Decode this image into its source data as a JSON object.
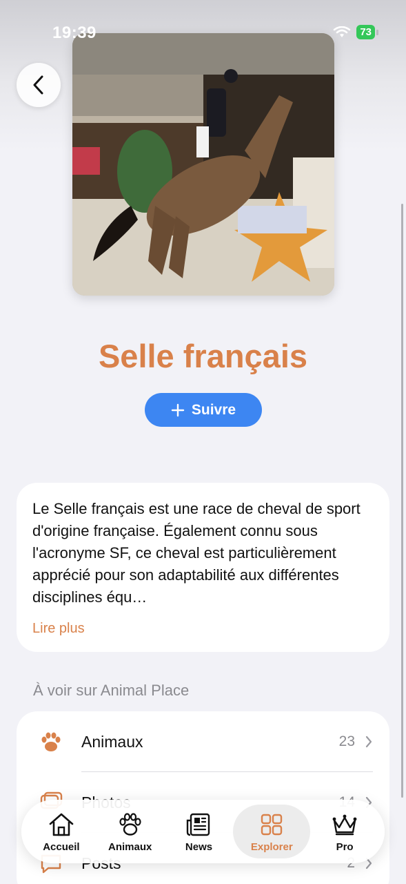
{
  "status": {
    "time": "19:39",
    "battery": "73"
  },
  "breed": {
    "title": "Selle français",
    "follow_label": "Suivre",
    "description": "Le Selle français est une race de cheval de sport d'origine française. Également connu sous l'acronyme SF, ce cheval est particulièrement apprécié pour son adaptabilité aux différentes disciplines équ…",
    "read_more": "Lire plus"
  },
  "section": {
    "title": "À voir sur Animal Place"
  },
  "list": [
    {
      "label": "Animaux",
      "count": "23",
      "icon": "paw-icon"
    },
    {
      "label": "Photos",
      "count": "14",
      "icon": "photos-icon"
    },
    {
      "label": "Posts",
      "count": "2",
      "icon": "posts-icon"
    }
  ],
  "tabs": [
    {
      "label": "Accueil",
      "icon": "home-icon"
    },
    {
      "label": "Animaux",
      "icon": "paw-icon"
    },
    {
      "label": "News",
      "icon": "newspaper-icon"
    },
    {
      "label": "Explorer",
      "icon": "grid-icon",
      "active": true
    },
    {
      "label": "Pro",
      "icon": "crown-icon"
    }
  ],
  "colors": {
    "accent": "#d9814a",
    "follow": "#3d86f2",
    "battery": "#34c759"
  }
}
